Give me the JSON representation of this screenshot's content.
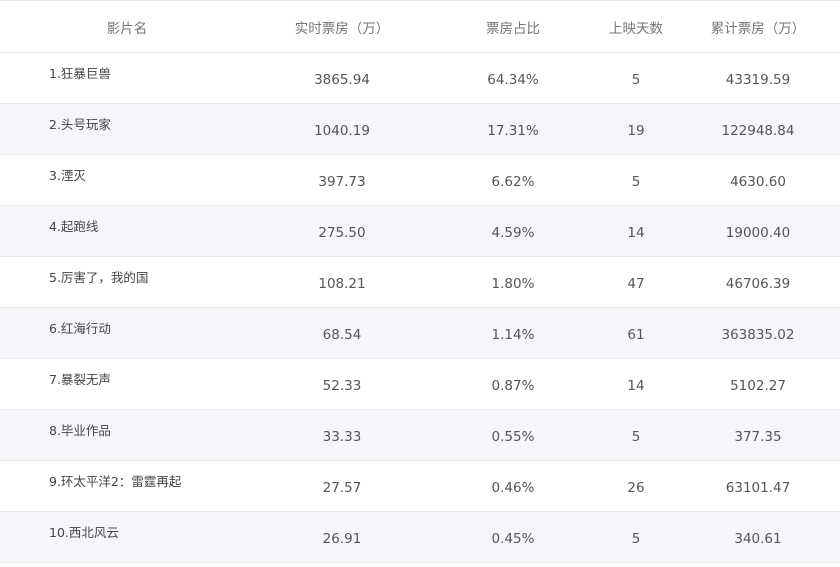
{
  "headers": [
    "影片名",
    "实时票房（万）",
    "票房占比",
    "上映天数",
    "累计票房（万）"
  ],
  "rows": [
    {
      "name": "1.狂暴巨兽",
      "realtime": "3865.94",
      "share": "64.34%",
      "days": "5",
      "total": "43319.59"
    },
    {
      "name": "2.头号玩家",
      "realtime": "1040.19",
      "share": "17.31%",
      "days": "19",
      "total": "122948.84"
    },
    {
      "name": "3.湮灭",
      "realtime": "397.73",
      "share": "6.62%",
      "days": "5",
      "total": "4630.60"
    },
    {
      "name": "4.起跑线",
      "realtime": "275.50",
      "share": "4.59%",
      "days": "14",
      "total": "19000.40"
    },
    {
      "name": "5.厉害了，我的国",
      "realtime": "108.21",
      "share": "1.80%",
      "days": "47",
      "total": "46706.39"
    },
    {
      "name": "6.红海行动",
      "realtime": "68.54",
      "share": "1.14%",
      "days": "61",
      "total": "363835.02"
    },
    {
      "name": "7.暴裂无声",
      "realtime": "52.33",
      "share": "0.87%",
      "days": "14",
      "total": "5102.27"
    },
    {
      "name": "8.毕业作品",
      "realtime": "33.33",
      "share": "0.55%",
      "days": "5",
      "total": "377.35"
    },
    {
      "name": "9.环太平洋2：雷霆再起",
      "realtime": "27.57",
      "share": "0.46%",
      "days": "26",
      "total": "63101.47"
    },
    {
      "name": "10.西北风云",
      "realtime": "26.91",
      "share": "0.45%",
      "days": "5",
      "total": "340.61"
    }
  ]
}
